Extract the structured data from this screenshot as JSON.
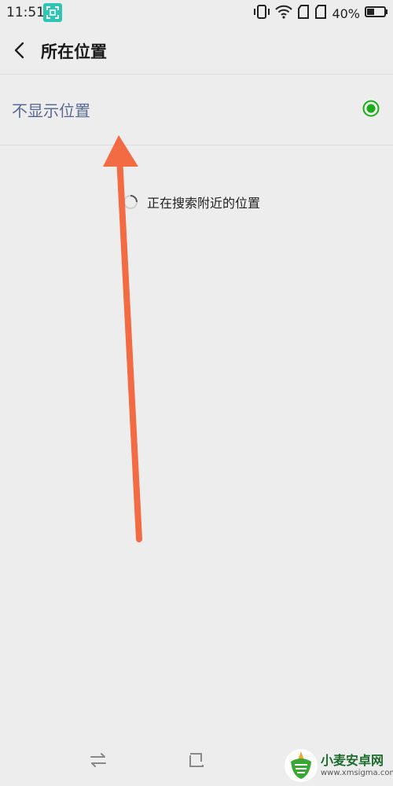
{
  "status_bar": {
    "time": "11:51",
    "battery_percent": "40%",
    "icons": [
      "scan-icon",
      "vibrate-icon",
      "wifi-icon",
      "sim1-icon",
      "sim2-icon",
      "battery-icon"
    ]
  },
  "header": {
    "title": "所在位置",
    "back_icon": "chevron-left-icon"
  },
  "options": [
    {
      "label": "不显示位置",
      "selected": true
    }
  ],
  "searching": {
    "text": "正在搜索附近的位置"
  },
  "annotation": {
    "color": "#f26b43"
  },
  "nav_bar": {
    "buttons": [
      "switch-icon",
      "home-square-icon",
      "back-triangle-icon"
    ]
  },
  "watermark": {
    "text": "小麦安卓网",
    "url": "www.xmsigma.com"
  },
  "colors": {
    "background": "#ededed",
    "accent_green": "#1aad19",
    "option_text": "#5a6a92"
  }
}
